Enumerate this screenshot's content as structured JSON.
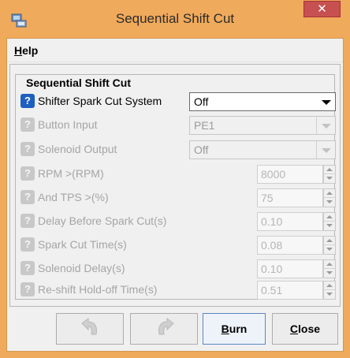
{
  "window": {
    "title": "Sequential Shift Cut",
    "close_glyph": "✕"
  },
  "menu": {
    "help_mnemonic": "H",
    "help_rest": "elp"
  },
  "group": {
    "title": "Sequential Shift Cut"
  },
  "rows": [
    {
      "label": "Shifter Spark Cut System",
      "value": "Off",
      "control": "dropdown",
      "enabled": true,
      "icon": "help-icon"
    },
    {
      "label": "Button Input",
      "value": "PE1",
      "control": "dropdown",
      "enabled": false,
      "icon": "help-icon"
    },
    {
      "label": "Solenoid Output",
      "value": "Off",
      "control": "dropdown",
      "enabled": false,
      "icon": "help-icon"
    },
    {
      "label": "RPM >(RPM)",
      "value": "8000",
      "control": "spinner",
      "enabled": false,
      "icon": "help-icon"
    },
    {
      "label": "And TPS >(%)",
      "value": "75",
      "control": "spinner",
      "enabled": false,
      "icon": "help-icon"
    },
    {
      "label": "Delay Before Spark Cut(s)",
      "value": "0.10",
      "control": "spinner",
      "enabled": false,
      "icon": "help-icon"
    },
    {
      "label": "Spark Cut Time(s)",
      "value": "0.08",
      "control": "spinner",
      "enabled": false,
      "icon": "help-icon"
    },
    {
      "label": "Solenoid Delay(s)",
      "value": "0.10",
      "control": "spinner",
      "enabled": false,
      "icon": "help-icon"
    },
    {
      "label": "Re-shift Hold-off Time(s)",
      "value": "0.51",
      "control": "spinner",
      "enabled": false,
      "icon": "help-icon"
    }
  ],
  "help_glyph": "?",
  "buttons": {
    "undo_icon": "undo-arrow-icon",
    "redo_icon": "redo-arrow-icon",
    "burn_mnemonic": "B",
    "burn_rest": "urn",
    "close_mnemonic": "C",
    "close_rest": "lose"
  },
  "colors": {
    "title_bar": "#f0aa5c",
    "close_button": "#c75050",
    "help_icon_active": "#1e5fc0",
    "help_icon_disabled": "#c8c8c8",
    "primary_button_border": "#5b86c3"
  }
}
